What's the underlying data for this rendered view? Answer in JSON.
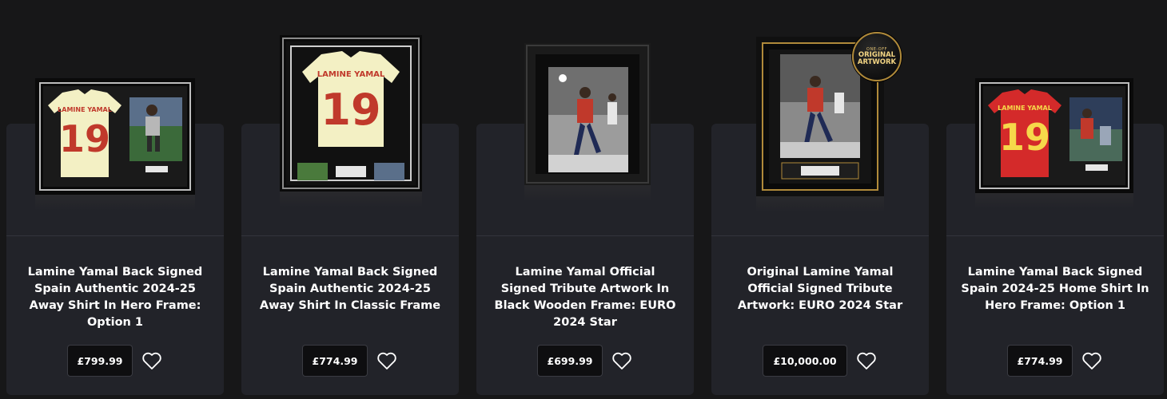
{
  "products": [
    {
      "title": "Lamine Yamal Back Signed Spain Authentic 2024-25 Away Shirt In Hero Frame: Option 1",
      "price": "£799.99",
      "shirt_name": "LAMINE YAMAL",
      "shirt_number": "19"
    },
    {
      "title": "Lamine Yamal Back Signed Spain Authentic 2024-25 Away Shirt In Classic Frame",
      "price": "£774.99",
      "shirt_name": "LAMINE YAMAL",
      "shirt_number": "19"
    },
    {
      "title": "Lamine Yamal Official Signed Tribute Artwork In Black Wooden Frame: EURO 2024 Star",
      "price": "£699.99"
    },
    {
      "title": "Original Lamine Yamal Official Signed Tribute Artwork: EURO 2024 Star",
      "price": "£10,000.00",
      "badge_top": "ONE-OFF",
      "badge_main": "ORIGINAL ARTWORK"
    },
    {
      "title": "Lamine Yamal Back Signed Spain 2024-25 Home Shirt In Hero Frame: Option 1",
      "price": "£774.99",
      "shirt_name": "LAMINE YAMAL",
      "shirt_number": "19"
    }
  ],
  "icons": {
    "wishlist": "heart-outline-icon"
  },
  "colors": {
    "background": "#171718",
    "card": "#222329",
    "price_bg": "#0e0e10",
    "away_shirt": "#f3f0c4",
    "home_shirt": "#d42a2a",
    "frame_gold": "#b08a3a"
  }
}
